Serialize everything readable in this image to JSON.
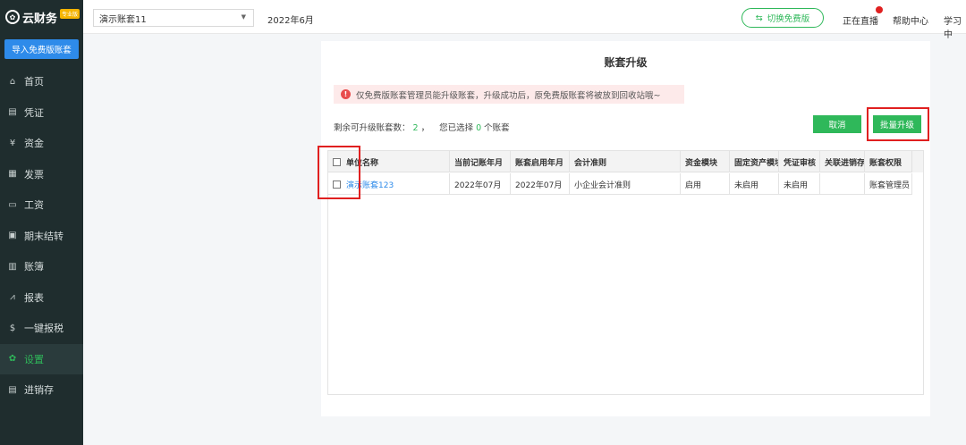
{
  "sidebar": {
    "logo_text": "云财务",
    "logo_badge": "专业版",
    "import_button": "导入免费版账套",
    "items": [
      {
        "label": "首页",
        "icon": "home-icon",
        "glyph": "⌂"
      },
      {
        "label": "凭证",
        "icon": "voucher-icon",
        "glyph": "▤"
      },
      {
        "label": "资金",
        "icon": "fund-icon",
        "glyph": "¥"
      },
      {
        "label": "发票",
        "icon": "invoice-icon",
        "glyph": "▦"
      },
      {
        "label": "工资",
        "icon": "salary-icon",
        "glyph": "▭"
      },
      {
        "label": "期末结转",
        "icon": "period-end-icon",
        "glyph": "▣"
      },
      {
        "label": "账簿",
        "icon": "ledger-icon",
        "glyph": "▥"
      },
      {
        "label": "报表",
        "icon": "report-icon",
        "glyph": "⩘"
      },
      {
        "label": "一键报税",
        "icon": "tax-icon",
        "glyph": "$"
      },
      {
        "label": "设置",
        "icon": "settings-icon",
        "glyph": "✿",
        "active": true
      },
      {
        "label": "进销存",
        "icon": "inventory-icon",
        "glyph": "▤"
      }
    ]
  },
  "topbar": {
    "book_select_value": "演示账套11",
    "period": "2022年6月",
    "switch_button": "切换免费版",
    "live_link": "正在直播",
    "help_link": "帮助中心",
    "study_link": "学习中"
  },
  "panel": {
    "title": "账套升级",
    "warning": "仅免费版账套管理员能升级账套，升级成功后，原免费版账套将被放到回收站哦~",
    "remaining_label": "剩余可升级账套数：",
    "remaining_count": "2",
    "remaining_sep": "，",
    "selected_prefix": "您已选择",
    "selected_count": "0",
    "selected_suffix": "个账套",
    "cancel_button": "取消",
    "batch_upgrade_button": "批量升级"
  },
  "table": {
    "headers": [
      "单位名称",
      "当前记账年月",
      "账套启用年月",
      "会计准则",
      "资金模块",
      "固定资产模块",
      "凭证审核",
      "关联进销存",
      "账套权限"
    ],
    "rows": [
      [
        "演示账套123",
        "2022年07月",
        "2022年07月",
        "小企业会计准则",
        "启用",
        "未启用",
        "未启用",
        "",
        "账套管理员"
      ]
    ]
  },
  "colors": {
    "accent_green": "#2fb85a",
    "link_blue": "#2e8bea",
    "highlight_red": "#e02020",
    "sidebar_bg": "#1f2d2e"
  }
}
